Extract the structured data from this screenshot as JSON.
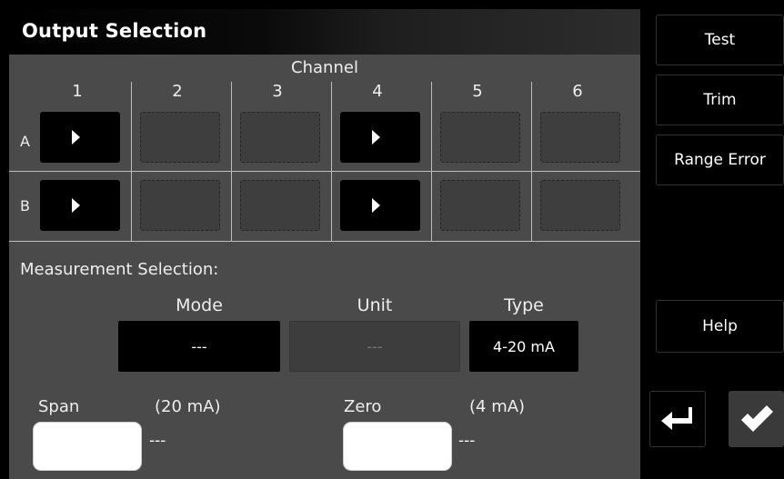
{
  "title": "Output Selection",
  "channel": {
    "label": "Channel",
    "columns": [
      "1",
      "2",
      "3",
      "4",
      "5",
      "6"
    ],
    "rows": [
      {
        "label": "A",
        "active": [
          true,
          false,
          false,
          true,
          false,
          false
        ]
      },
      {
        "label": "B",
        "active": [
          true,
          false,
          false,
          true,
          false,
          false
        ]
      }
    ]
  },
  "measurement": {
    "label": "Measurement Selection:",
    "mode_header": "Mode",
    "unit_header": "Unit",
    "type_header": "Type",
    "mode_value": "---",
    "unit_value": "---",
    "type_value": "4-20 mA"
  },
  "span": {
    "label": "Span",
    "hint": "(20 mA)",
    "value": "---"
  },
  "zero": {
    "label": "Zero",
    "hint": "(4 mA)",
    "value": "---"
  },
  "buttons": {
    "test": "Test",
    "trim": "Trim",
    "range_error": "Range Error",
    "help": "Help"
  },
  "icons": {
    "back": "return-arrow-icon",
    "ok": "checkmark-icon"
  },
  "colors": {
    "panel": "#4a4a4a",
    "button": "#000000",
    "ok_button": "#3a3a3a"
  }
}
